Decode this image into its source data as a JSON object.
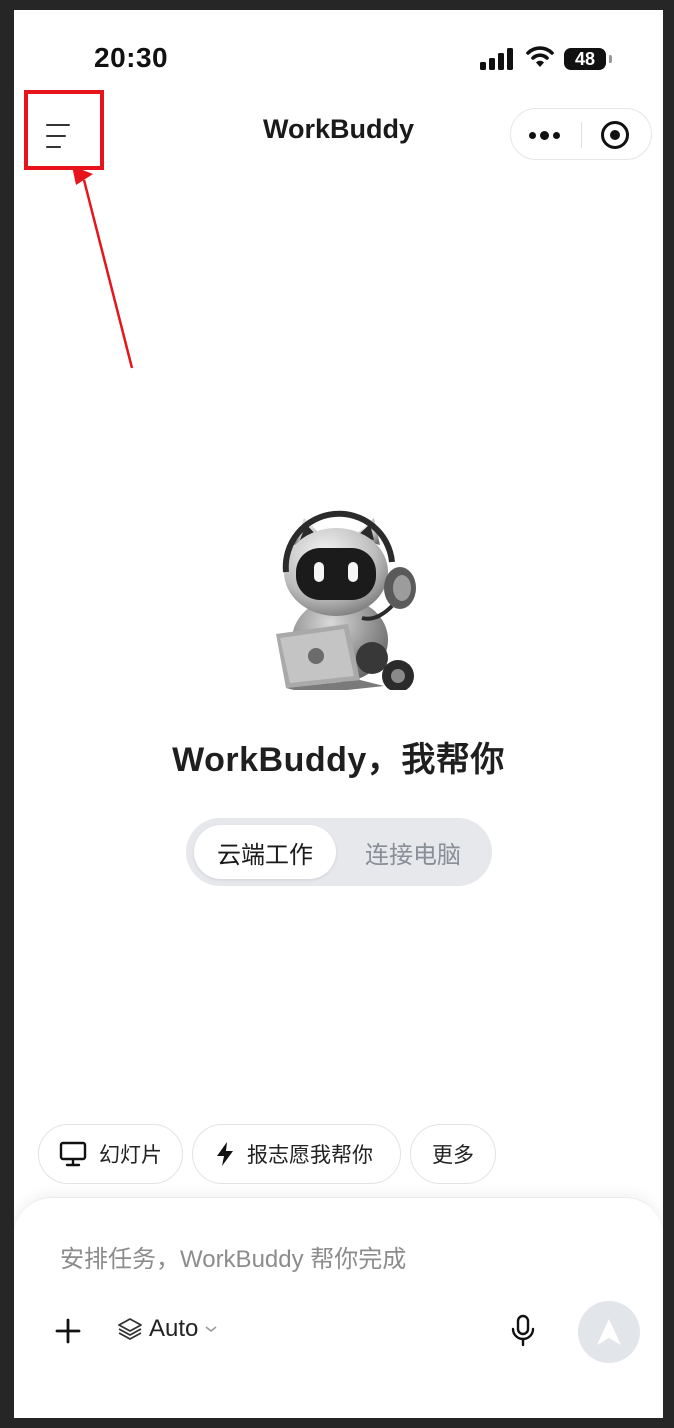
{
  "status_bar": {
    "time": "20:30",
    "battery": "48",
    "icons": [
      "signal-icon",
      "wifi-icon",
      "battery-icon"
    ]
  },
  "header": {
    "title": "WorkBuddy",
    "menu_icon": "menu-icon",
    "more_icon": "more-dots-icon",
    "close_icon": "target-icon"
  },
  "annotation": {
    "highlight_color": "#e8141b"
  },
  "hero": {
    "headline": "WorkBuddy，我帮你",
    "mascot": "robot-mascot-with-laptop"
  },
  "mode_toggle": {
    "options": [
      "云端工作",
      "连接电脑"
    ],
    "selected": "云端工作"
  },
  "quick_actions": [
    {
      "label": "幻灯片",
      "icon": "monitor-icon"
    },
    {
      "label": "报志愿我帮你",
      "icon": "lightning-icon"
    },
    {
      "label": "更多",
      "icon": ""
    }
  ],
  "composer": {
    "placeholder": "安排任务，WorkBuddy 帮你完成",
    "model_label": "Auto",
    "icons": [
      "plus-icon",
      "layers-icon",
      "chevron-down-icon",
      "microphone-icon",
      "send-icon"
    ]
  },
  "colors": {
    "accent_red": "#e8141b",
    "segment_bg": "#e6e8ec",
    "send_bg": "#e2e5ea"
  }
}
